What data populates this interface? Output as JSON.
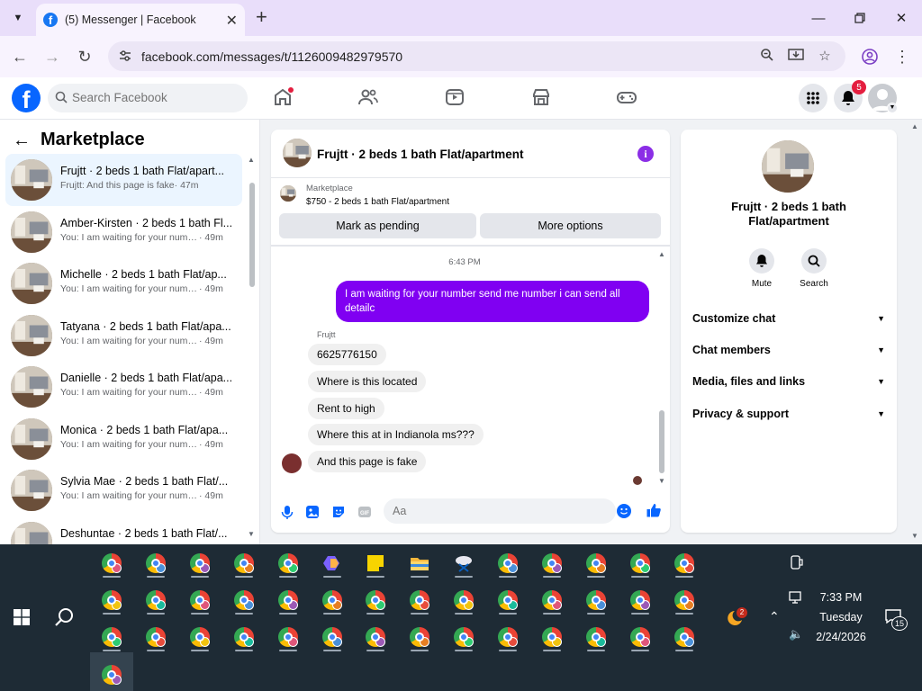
{
  "browser": {
    "tab_title": "(5) Messenger | Facebook",
    "url": "facebook.com/messages/t/1126009482979570"
  },
  "fb_header": {
    "search_placeholder": "Search Facebook",
    "notification_count": "5"
  },
  "sidebar": {
    "title": "Marketplace",
    "conversations": [
      {
        "name": "Frujtt · 2 beds 1 bath Flat/apart...",
        "preview": "Frujtt: And this page is fake",
        "time": "· 47m",
        "active": true
      },
      {
        "name": "Amber-Kirsten · 2 beds 1 bath Fl...",
        "preview": "You: I am waiting for your numb...",
        "time": "· 49m"
      },
      {
        "name": "Michelle · 2 beds 1 bath Flat/ap...",
        "preview": "You: I am waiting for your numb...",
        "time": "· 49m"
      },
      {
        "name": "Tatyana · 2 beds 1 bath Flat/apa...",
        "preview": "You: I am waiting for your numb...",
        "time": "· 49m"
      },
      {
        "name": "Danielle · 2 beds 1 bath Flat/apa...",
        "preview": "You: I am waiting for your numb...",
        "time": "· 49m"
      },
      {
        "name": "Monica · 2 beds 1 bath Flat/apa...",
        "preview": "You: I am waiting for your numb...",
        "time": "· 49m"
      },
      {
        "name": "Sylvia Mae · 2 beds 1 bath Flat/...",
        "preview": "You: I am waiting for your numb...",
        "time": "· 49m"
      },
      {
        "name": "Deshuntae · 2 beds 1 bath Flat/...",
        "preview": "",
        "time": ""
      }
    ]
  },
  "chat": {
    "title": "Frujtt · 2 beds 1 bath Flat/apartment",
    "banner_label": "Marketplace",
    "banner_item": "$750 - 2 beds 1 bath Flat/apartment",
    "mark_pending": "Mark as pending",
    "more_options": "More options",
    "timestamp": "6:43 PM",
    "outgoing": "I am waiting for your number  send me number i can send all detailc",
    "sender": "Frujtt",
    "incoming": [
      "6625776150",
      "Where is this located",
      "Rent to high",
      "Where this at in Indianola ms???",
      "And this page is fake"
    ],
    "composer_placeholder": "Aa",
    "accent_color": "#8000f2"
  },
  "right_panel": {
    "name": "Frujtt · 2 beds 1 bath Flat/apartment",
    "mute": "Mute",
    "search": "Search",
    "sections": [
      "Customize chat",
      "Chat members",
      "Media, files and links",
      "Privacy & support"
    ]
  },
  "taskbar": {
    "time": "7:33 PM",
    "day": "Tuesday",
    "date": "2/24/2026",
    "notification_count": "15",
    "weather_badge": "2"
  }
}
